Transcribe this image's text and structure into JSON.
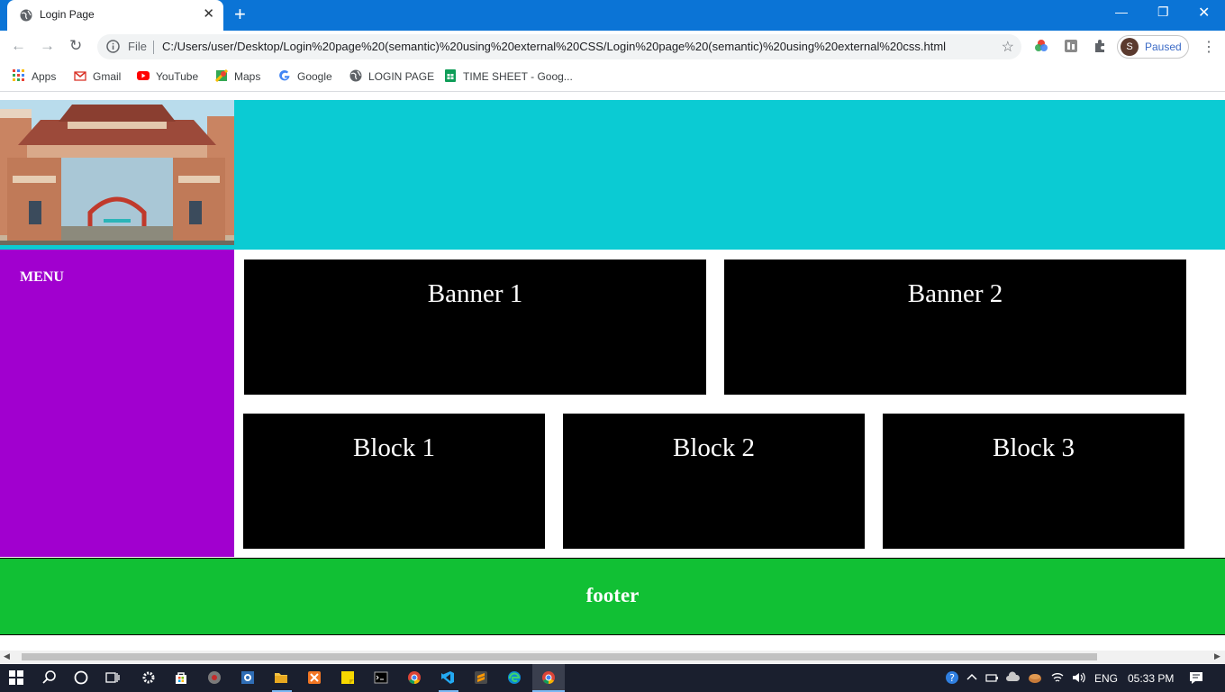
{
  "browser": {
    "tab_title": "Login Page",
    "new_tab_symbol": "+",
    "address": {
      "scheme_label": "File",
      "url": "C:/Users/user/Desktop/Login%20page%20(semantic)%20using%20external%20CSS/Login%20page%20(semantic)%20using%20external%20css.html"
    },
    "profile": {
      "initial": "S",
      "status": "Paused"
    },
    "bookmarks": [
      {
        "label": "Apps",
        "icon": "apps-grid-icon",
        "color": "#ea4335"
      },
      {
        "label": "Gmail",
        "icon": "gmail-icon",
        "color": "#d93025"
      },
      {
        "label": "YouTube",
        "icon": "youtube-icon",
        "color": "#ff0000"
      },
      {
        "label": "Maps",
        "icon": "maps-icon",
        "color": "#34a853"
      },
      {
        "label": "Google",
        "icon": "google-icon",
        "color": "#4285f4"
      },
      {
        "label": "LOGIN PAGE",
        "icon": "globe-icon",
        "color": "#5f6368"
      },
      {
        "label": "TIME SHEET - Goog...",
        "icon": "sheets-icon",
        "color": "#0f9d58"
      }
    ]
  },
  "page": {
    "menu_label": "MENU",
    "banners": [
      "Banner 1",
      "Banner 2"
    ],
    "blocks": [
      "Block 1",
      "Block 2",
      "Block 3"
    ],
    "footer": "footer",
    "colors": {
      "header": "#0bcbd3",
      "sidebar": "#a100cf",
      "panel": "#000000",
      "footer": "#11c034"
    }
  },
  "taskbar": {
    "language": "ENG",
    "time": "05:33 PM"
  }
}
